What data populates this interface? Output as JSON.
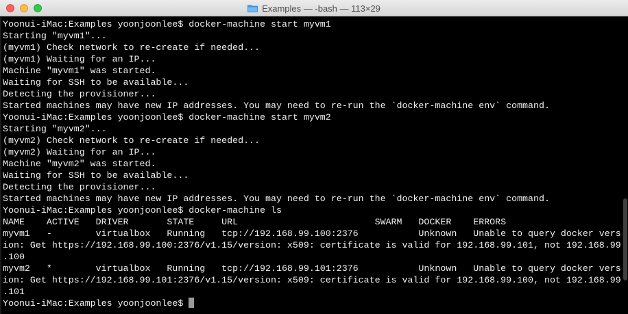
{
  "window": {
    "title": "Examples — -bash — 113×29"
  },
  "terminal": {
    "lines": [
      "Yoonui-iMac:Examples yoonjoonlee$ docker-machine start myvm1",
      "Starting \"myvm1\"...",
      "(myvm1) Check network to re-create if needed...",
      "(myvm1) Waiting for an IP...",
      "Machine \"myvm1\" was started.",
      "Waiting for SSH to be available...",
      "Detecting the provisioner...",
      "Started machines may have new IP addresses. You may need to re-run the `docker-machine env` command.",
      "Yoonui-iMac:Examples yoonjoonlee$ docker-machine start myvm2",
      "Starting \"myvm2\"...",
      "(myvm2) Check network to re-create if needed...",
      "(myvm2) Waiting for an IP...",
      "Machine \"myvm2\" was started.",
      "Waiting for SSH to be available...",
      "Detecting the provisioner...",
      "Started machines may have new IP addresses. You may need to re-run the `docker-machine env` command.",
      "Yoonui-iMac:Examples yoonjoonlee$ docker-machine ls",
      "NAME    ACTIVE   DRIVER       STATE     URL                         SWARM   DOCKER    ERRORS",
      "myvm1   -        virtualbox   Running   tcp://192.168.99.100:2376           Unknown   Unable to query docker vers",
      "ion: Get https://192.168.99.100:2376/v1.15/version: x509: certificate is valid for 192.168.99.101, not 192.168.99",
      ".100",
      "myvm2   *        virtualbox   Running   tcp://192.168.99.101:2376           Unknown   Unable to query docker vers",
      "ion: Get https://192.168.99.101:2376/v1.15/version: x509: certificate is valid for 192.168.99.100, not 192.168.99",
      ".101"
    ],
    "prompt": "Yoonui-iMac:Examples yoonjoonlee$ "
  },
  "icons": {
    "title_icon": "folder-icon",
    "buttons": [
      "close-icon",
      "minimize-icon",
      "zoom-icon"
    ]
  },
  "colors": {
    "background": "#000000",
    "text": "#f0f0f0",
    "cursor": "#9a9a9a",
    "folder": "#5aa8e8"
  }
}
